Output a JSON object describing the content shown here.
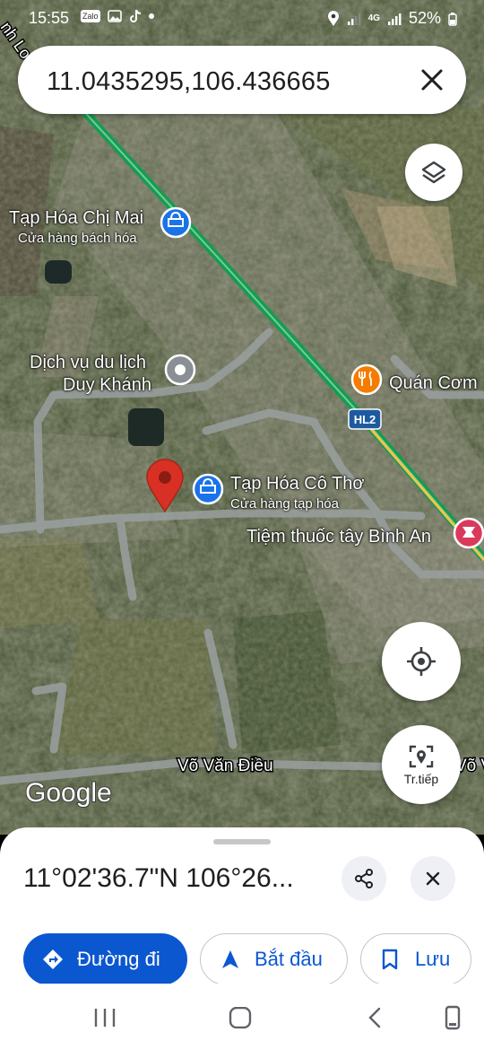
{
  "status_bar": {
    "time": "15:55",
    "zalo": "Zalo",
    "network": "4G",
    "battery": "52%"
  },
  "search": {
    "query": "11.0435295,106.436665"
  },
  "map": {
    "pois": [
      {
        "name": "Tạp Hóa Chị Mai",
        "category": "Cửa hàng bách hóa",
        "icon": "shopping-bag-icon"
      },
      {
        "name": "Dịch vụ du lịch",
        "name2": "Duy Khánh",
        "icon": "place-icon"
      },
      {
        "name": "Quán Cơm",
        "icon": "restaurant-icon"
      },
      {
        "name": "Tạp Hóa Cô Thơ",
        "category": "Cửa hàng tạp hóa",
        "icon": "shopping-bag-icon"
      },
      {
        "name": "Tiệm thuốc tây Bình An",
        "icon": "pharmacy-icon"
      }
    ],
    "road_label": "Võ Văn Điều",
    "road_label_cut": "Võ V",
    "road_edge_label": "nh Lo",
    "highway_shield": "HL2",
    "google_logo": "Google",
    "pin_color": "#d93025",
    "route_color": "#1fa15a"
  },
  "controls": {
    "layers": "layers-icon",
    "my_location": "my-location-icon",
    "street_view_label": "Tr.tiếp"
  },
  "sheet": {
    "coordinates": "11°02'36.7\"N 106°26...",
    "buttons": {
      "directions": "Đường đi",
      "start": "Bắt đầu",
      "save": "Lưu"
    },
    "accent": "#0b57d0"
  }
}
